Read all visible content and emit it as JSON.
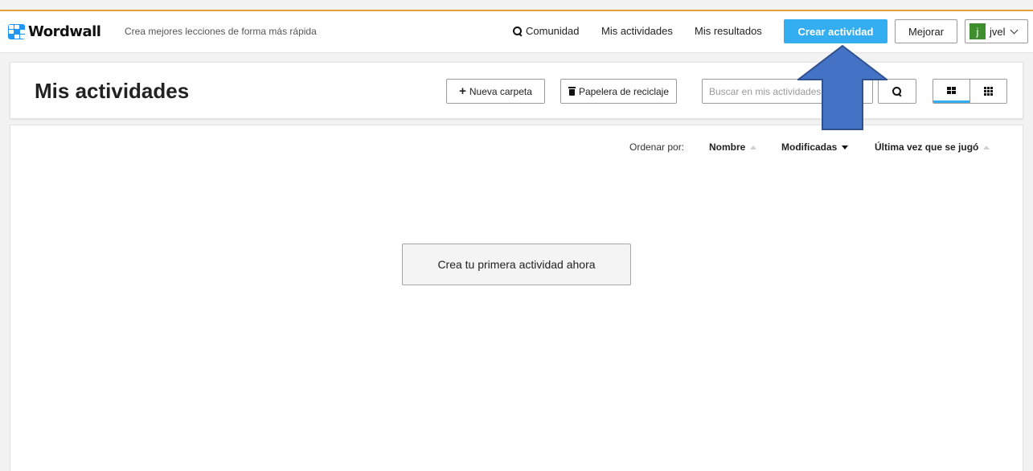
{
  "header": {
    "logo_text": "Wordwall",
    "tagline": "Crea mejores lecciones de forma más rápida",
    "nav": {
      "community": "Comunidad",
      "my_activities": "Mis actividades",
      "my_results": "Mis resultados"
    },
    "create_button": "Crear actividad",
    "upgrade_button": "Mejorar",
    "user": {
      "avatar_letter": "j",
      "name": "jvel"
    }
  },
  "toolbar": {
    "page_title": "Mis actividades",
    "new_folder": "Nueva carpeta",
    "recycle_bin": "Papelera de reciclaje",
    "search_placeholder": "Buscar en mis actividades"
  },
  "sort": {
    "label": "Ordenar por:",
    "options": [
      "Nombre",
      "Modificadas",
      "Última vez que se jugó"
    ],
    "active": "Modificadas"
  },
  "empty_state": {
    "button": "Crea tu primera actividad ahora"
  },
  "colors": {
    "accent": "#34aef0",
    "logo_blue": "#2196f3",
    "avatar": "#3f8f2e",
    "annotation_arrow": "#4472c4",
    "top_stripe": "#e8a23a"
  },
  "icons": [
    "logo-icon",
    "search-icon",
    "chevron-down-icon",
    "plus-icon",
    "trash-icon",
    "grid-large-icon",
    "grid-small-icon",
    "sort-up-icon",
    "sort-down-icon",
    "annotation-arrow-icon"
  ]
}
